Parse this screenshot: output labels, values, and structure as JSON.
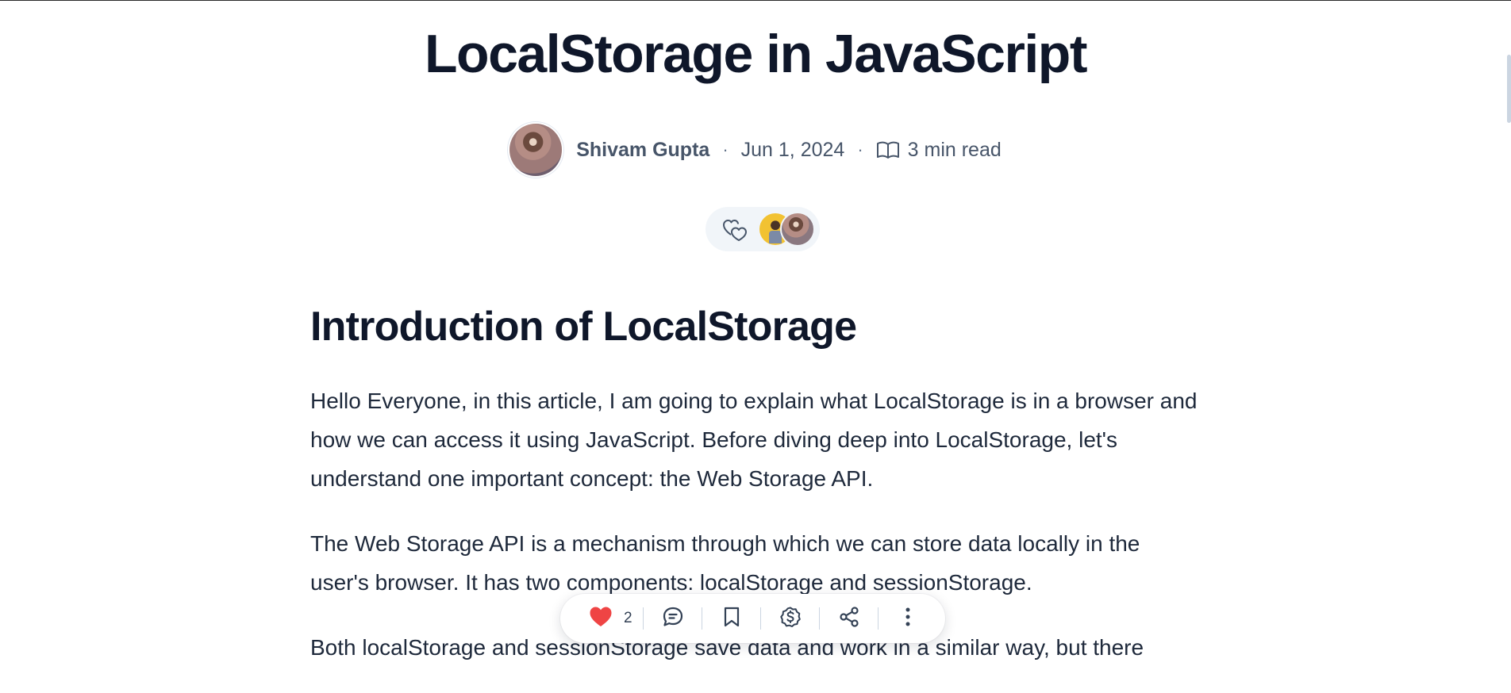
{
  "article": {
    "title": "LocalStorage in JavaScript",
    "author": "Shivam Gupta",
    "separator": "·",
    "date": "Jun 1, 2024",
    "read_time": "3 min read",
    "heading": "Introduction of LocalStorage",
    "paragraphs": [
      "Hello Everyone, in this article, I am going to explain what LocalStorage is in a browser and how we can access it using JavaScript. Before diving deep into LocalStorage, let's understand one important concept: the Web Storage API.",
      "The Web Storage API is a mechanism through which we can store data locally in the user's browser. It has two components: localStorage and sessionStorage.",
      "Both localStorage and sessionStorage save data and work in a similar way, but there"
    ]
  },
  "toolbar": {
    "like_count": "2",
    "icons": [
      "heart-icon",
      "comment-icon",
      "bookmark-icon",
      "sponsor-icon",
      "share-icon",
      "more-icon"
    ]
  },
  "colors": {
    "heart": "#ef4444",
    "text": "#1e293b",
    "muted": "#475569"
  }
}
